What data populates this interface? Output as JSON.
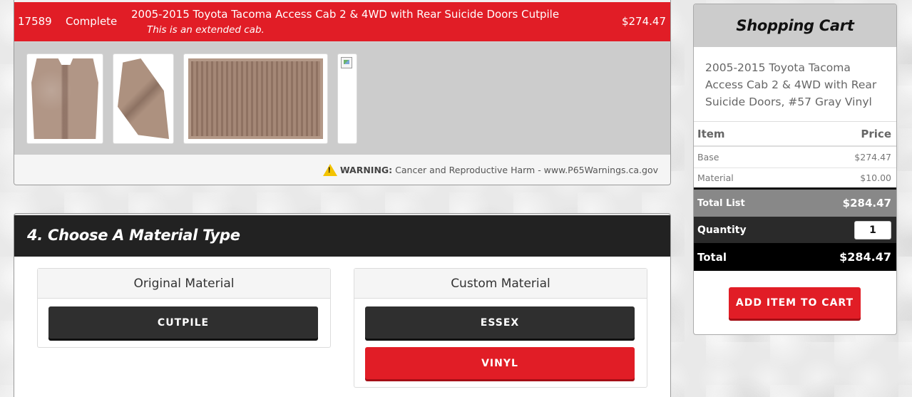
{
  "product": {
    "id": "17589",
    "status": "Complete",
    "title": "2005-2015 Toyota Tacoma Access Cab 2 & 4WD with Rear Suicide Doors Cutpile",
    "subtitle": "This is an extended cab.",
    "price": "$274.47",
    "gallery": [
      "carpet-front-image",
      "carpet-side-image",
      "floor-mat-image",
      "broken-image-placeholder"
    ]
  },
  "warning": {
    "label": "WARNING:",
    "text": "Cancer and Reproductive Harm - www.P65Warnings.ca.gov"
  },
  "material_section": {
    "title": "4. Choose A Material Type",
    "original": {
      "heading": "Original Material",
      "options": [
        "CUTPILE"
      ]
    },
    "custom": {
      "heading": "Custom Material",
      "options": [
        "ESSEX",
        "VINYL"
      ]
    }
  },
  "cart": {
    "title": "Shopping Cart",
    "description": "2005-2015 Toyota Tacoma Access Cab 2 & 4WD with Rear Suicide Doors, #57 Gray Vinyl",
    "col_item": "Item",
    "col_price": "Price",
    "lines": [
      {
        "label": "Base",
        "value": "$274.47"
      },
      {
        "label": "Material",
        "value": "$10.00"
      }
    ],
    "total_list_label": "Total List",
    "total_list_value": "$284.47",
    "quantity_label": "Quantity",
    "quantity_value": "1",
    "total_label": "Total",
    "total_value": "$284.47",
    "add_button": "ADD ITEM TO CART"
  },
  "colors": {
    "accent_red": "#e11d26",
    "dark": "#222222",
    "warning_yellow": "#f3c300"
  }
}
